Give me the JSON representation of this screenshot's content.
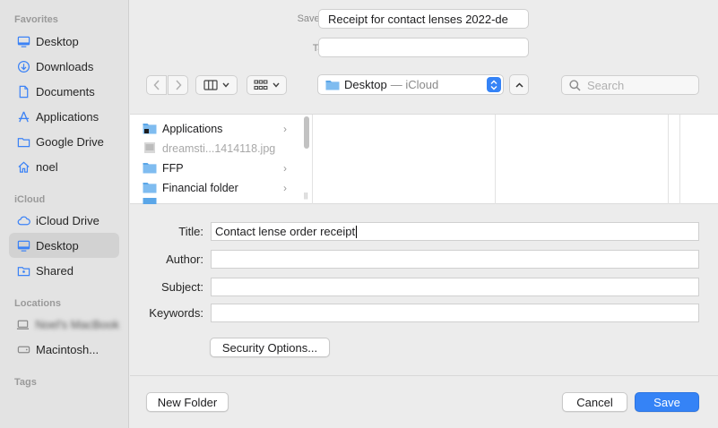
{
  "sidebar": {
    "sections": [
      {
        "title": "Favorites",
        "items": [
          {
            "label": "Desktop",
            "icon": "desktop-icon"
          },
          {
            "label": "Downloads",
            "icon": "downloads-icon"
          },
          {
            "label": "Documents",
            "icon": "documents-icon"
          },
          {
            "label": "Applications",
            "icon": "applications-icon"
          },
          {
            "label": "Google Drive",
            "icon": "folder-icon"
          },
          {
            "label": "noel",
            "icon": "home-icon"
          }
        ]
      },
      {
        "title": "iCloud",
        "items": [
          {
            "label": "iCloud Drive",
            "icon": "cloud-icon"
          },
          {
            "label": "Desktop",
            "icon": "desktop-icon",
            "selected": true
          },
          {
            "label": "Shared",
            "icon": "shared-folder-icon"
          }
        ]
      },
      {
        "title": "Locations",
        "items": [
          {
            "label": "Noel's MacBook",
            "icon": "laptop-icon",
            "blurred": true
          },
          {
            "label": "Macintosh...",
            "icon": "disk-icon"
          }
        ]
      },
      {
        "title": "Tags",
        "items": []
      }
    ]
  },
  "save": {
    "save_as_label": "Save As:",
    "save_as_value": "Receipt for contact lenses 2022-de",
    "tags_label": "Tags:",
    "tags_value": ""
  },
  "toolbar": {
    "location": "Desktop",
    "location_suffix": "— iCloud",
    "search_placeholder": "Search"
  },
  "files": [
    {
      "name": "Applications",
      "type": "folder",
      "has_children": true
    },
    {
      "name": "dreamsti...1414118.jpg",
      "type": "image",
      "dim": true
    },
    {
      "name": "FFP",
      "type": "folder",
      "has_children": true
    },
    {
      "name": "Financial folder",
      "type": "folder",
      "has_children": true
    }
  ],
  "metadata": {
    "title_label": "Title:",
    "title_value": "Contact lense order receipt",
    "author_label": "Author:",
    "author_value": "",
    "subject_label": "Subject:",
    "subject_value": "",
    "keywords_label": "Keywords:",
    "keywords_value": ""
  },
  "buttons": {
    "security": "Security Options...",
    "new_folder": "New Folder",
    "cancel": "Cancel",
    "save": "Save"
  },
  "colors": {
    "accent": "#3583f6",
    "sidebar_icon": "#3b82f6",
    "folder": "#5aa6e8"
  }
}
